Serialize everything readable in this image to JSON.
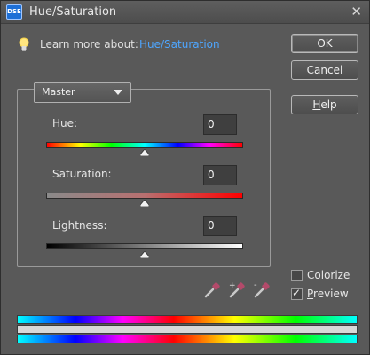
{
  "window": {
    "title": "Hue/Saturation",
    "app_badge": "DSE"
  },
  "learn": {
    "label": "Learn more about:",
    "link": "Hue/Saturation"
  },
  "buttons": {
    "ok": "OK",
    "cancel": "Cancel",
    "help_u": "H",
    "help_rest": "elp"
  },
  "channel": {
    "selected": "Master"
  },
  "sliders": {
    "hue": {
      "label": "Hue:",
      "value": "0"
    },
    "saturation": {
      "label": "Saturation:",
      "value": "0"
    },
    "lightness": {
      "label": "Lightness:",
      "value": "0"
    }
  },
  "options": {
    "colorize": {
      "u": "C",
      "rest": "olorize",
      "checked": false
    },
    "preview": {
      "u": "P",
      "rest": "review",
      "checked": true
    }
  },
  "icons": [
    "close-icon",
    "lightbulb-icon",
    "chevron-down-icon",
    "eyedropper-icon",
    "eyedropper-plus-icon",
    "eyedropper-minus-icon"
  ],
  "colors": {
    "link": "#4ea6ff",
    "background": "#595959"
  }
}
